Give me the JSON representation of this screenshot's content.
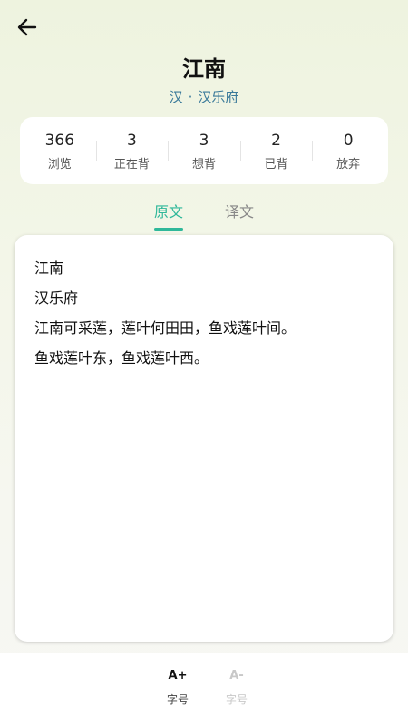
{
  "header": {
    "title": "江南",
    "dynasty": "汉",
    "separator": "·",
    "author": "汉乐府"
  },
  "stats": [
    {
      "value": "366",
      "label": "浏览"
    },
    {
      "value": "3",
      "label": "正在背"
    },
    {
      "value": "3",
      "label": "想背"
    },
    {
      "value": "2",
      "label": "已背"
    },
    {
      "value": "0",
      "label": "放弃"
    }
  ],
  "tabs": [
    {
      "label": "原文",
      "active": true
    },
    {
      "label": "译文",
      "active": false
    }
  ],
  "content": {
    "lines": [
      "江南",
      "汉乐府",
      "江南可采莲，莲叶何田田，鱼戏莲叶间。",
      "鱼戏莲叶东，鱼戏莲叶西。"
    ]
  },
  "bottom_bar": {
    "increase": {
      "icon_text": "A+",
      "label": "字号"
    },
    "decrease": {
      "icon_text": "A-",
      "label": "字号"
    }
  },
  "colors": {
    "accent": "#2fb89a",
    "subtitle": "#3b7a9a"
  }
}
